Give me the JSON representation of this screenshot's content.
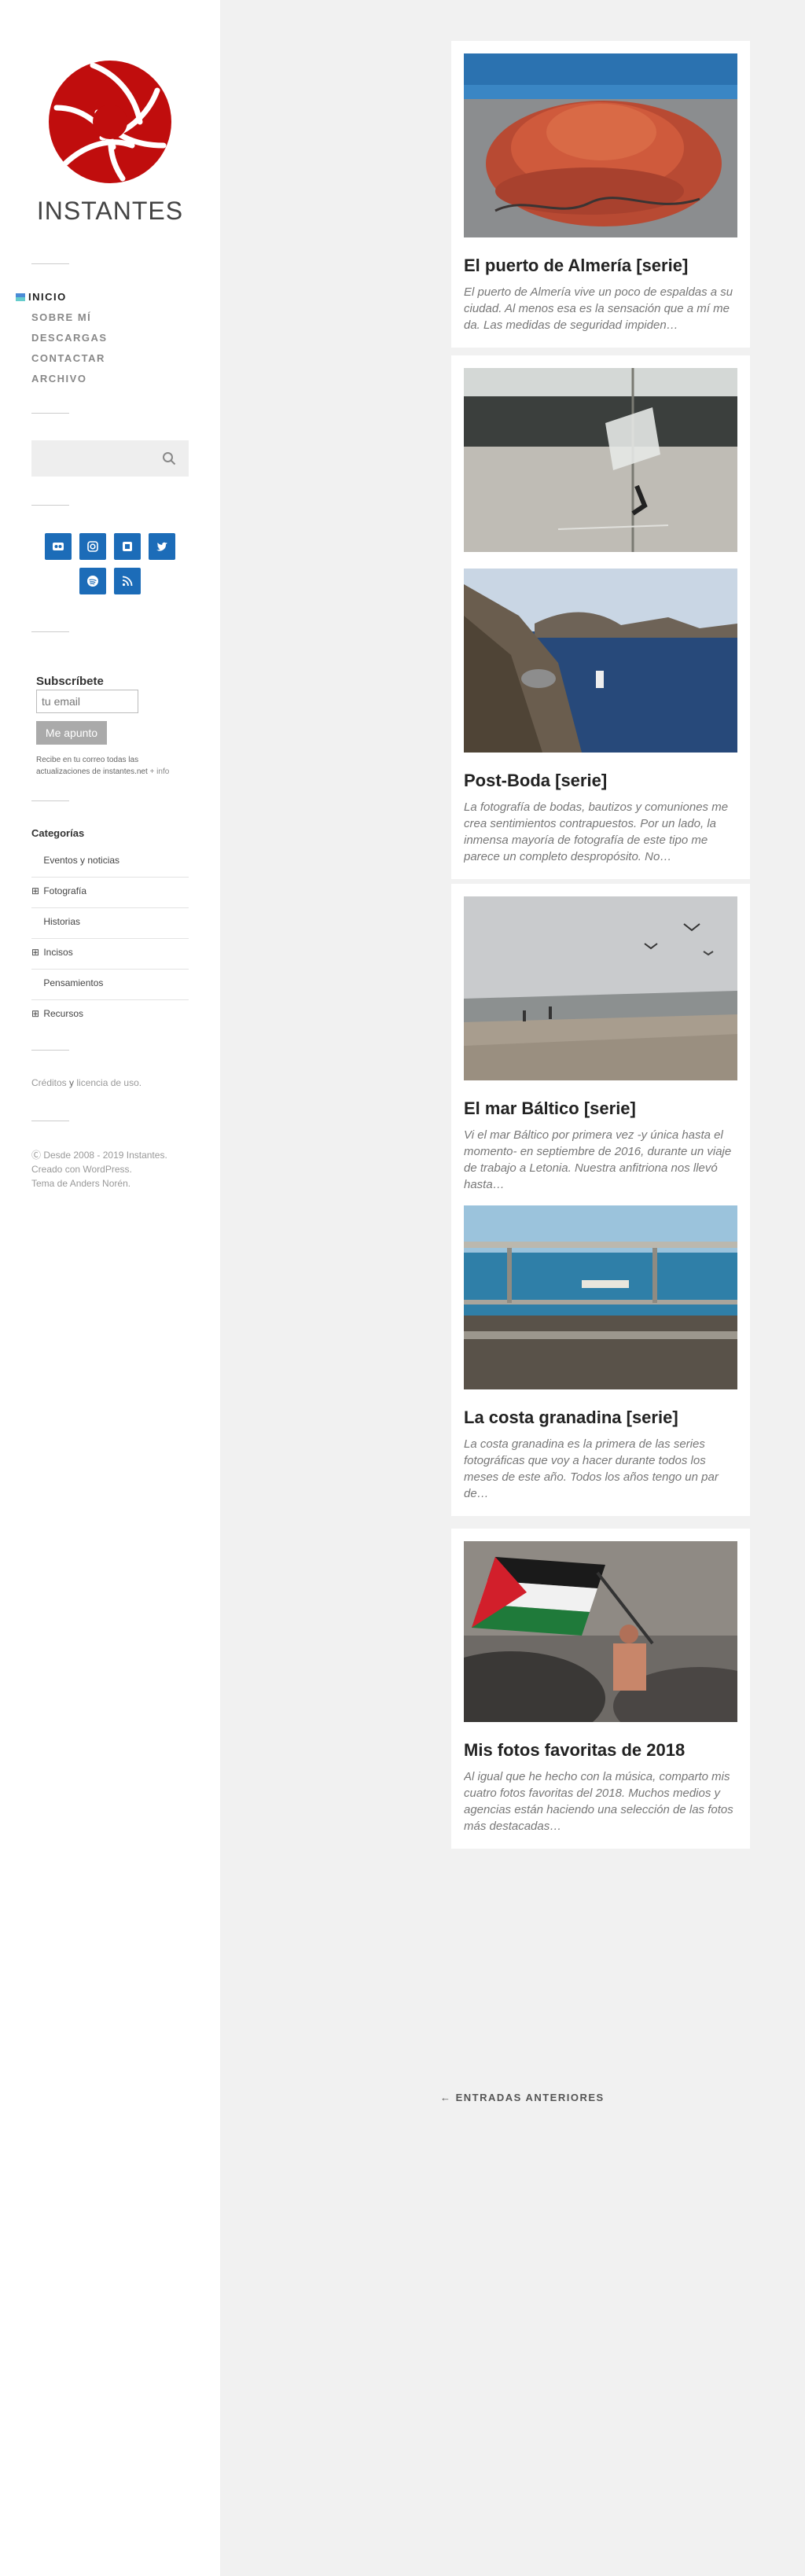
{
  "site": {
    "title": "INSTANTES"
  },
  "nav": {
    "items": [
      {
        "label": "INICIO"
      },
      {
        "label": "SOBRE MÍ"
      },
      {
        "label": "DESCARGAS"
      },
      {
        "label": "CONTACTAR"
      },
      {
        "label": "ARCHIVO"
      }
    ]
  },
  "search": {
    "icon": "search-icon"
  },
  "social": {
    "colors": {
      "button": "#1c6cb8"
    },
    "icons": [
      "flickr-icon",
      "instagram-icon",
      "px500-icon",
      "twitter-icon",
      "spotify-icon",
      "rss-icon"
    ]
  },
  "subscribe": {
    "heading": "Subscríbete",
    "placeholder": "tu email",
    "button": "Me apunto",
    "note": "Recibe en tu correo todas las actualizaciones de instantes.net",
    "more": "+ info"
  },
  "categories": {
    "heading": "Categorías",
    "items": [
      {
        "label": "Eventos y noticias",
        "expand": ""
      },
      {
        "label": "Fotografía",
        "expand": "⊞"
      },
      {
        "label": "Historias",
        "expand": ""
      },
      {
        "label": "Incisos",
        "expand": "⊞"
      },
      {
        "label": "Pensamientos",
        "expand": ""
      },
      {
        "label": "Recursos",
        "expand": "⊞"
      }
    ]
  },
  "footer": {
    "credits_a": "Créditos",
    "credits_and": "y",
    "credits_b": "licencia de uso",
    "credits_end": ".",
    "copy1": "Ⓒ Desde 2008 - 2019 Instantes.",
    "copy2": "Creado con WordPress.",
    "copy3": "Tema de Anders Norén."
  },
  "posts": [
    {
      "title": "El puerto de Almería [serie]",
      "excerpt": "El puerto de Almería vive un poco de espaldas a su ciudad. Al menos esa es la sensación que a mí me da. Las medidas de seguridad impiden…"
    },
    {
      "title": "Post-Boda [serie]",
      "excerpt": "La fotografía de bodas, bautizos y comuniones me crea sentimientos contrapuestos. Por un lado,  la inmensa mayoría de fotografía de este tipo me parece un completo despropósito. No…"
    },
    {
      "title": "El mar Báltico [serie]",
      "excerpt": "Vi el mar Báltico por primera vez -y única hasta el momento- en septiembre de 2016, durante un viaje de trabajo a Letonia. Nuestra anfitriona nos llevó hasta…"
    },
    {
      "title": "La costa granadina [serie]",
      "excerpt": "La costa granadina es la primera de las series fotográficas que voy a hacer durante todos los meses de este año. Todos los años tengo un par de…"
    },
    {
      "title": "Mis fotos favoritas de 2018",
      "excerpt": "Al igual que he hecho con la música, comparto mis cuatro fotos favoritas del 2018. Muchos medios y agencias están haciendo una selección de las fotos más destacadas…"
    }
  ],
  "pagination": {
    "older": "← ENTRADAS ANTERIORES"
  }
}
